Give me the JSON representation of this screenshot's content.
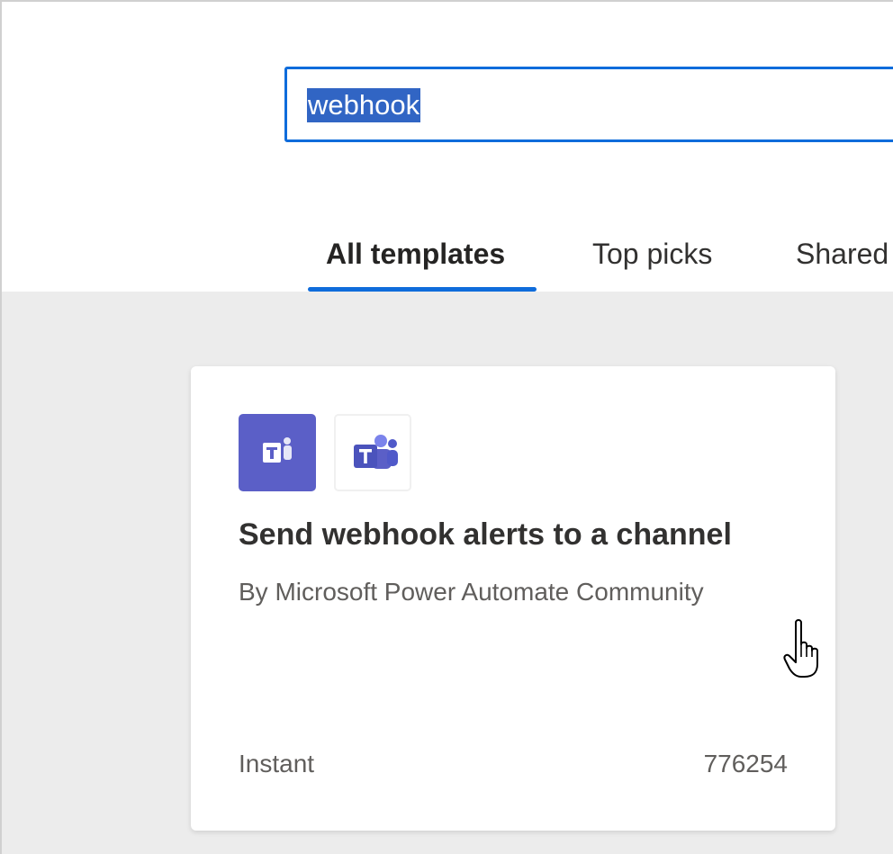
{
  "search": {
    "value": "webhook"
  },
  "tabs": [
    {
      "label": "All templates",
      "active": true
    },
    {
      "label": "Top picks",
      "active": false
    },
    {
      "label": "Shared",
      "active": false
    }
  ],
  "card": {
    "title": "Send webhook alerts to a channel",
    "author": "By Microsoft Power Automate Community",
    "type": "Instant",
    "count": "776254",
    "icons": [
      "teams-connector-icon",
      "teams-logo-icon"
    ]
  },
  "colors": {
    "accent": "#0f6cdb",
    "teams_purple": "#5b5fc7",
    "content_bg": "#ececec"
  }
}
